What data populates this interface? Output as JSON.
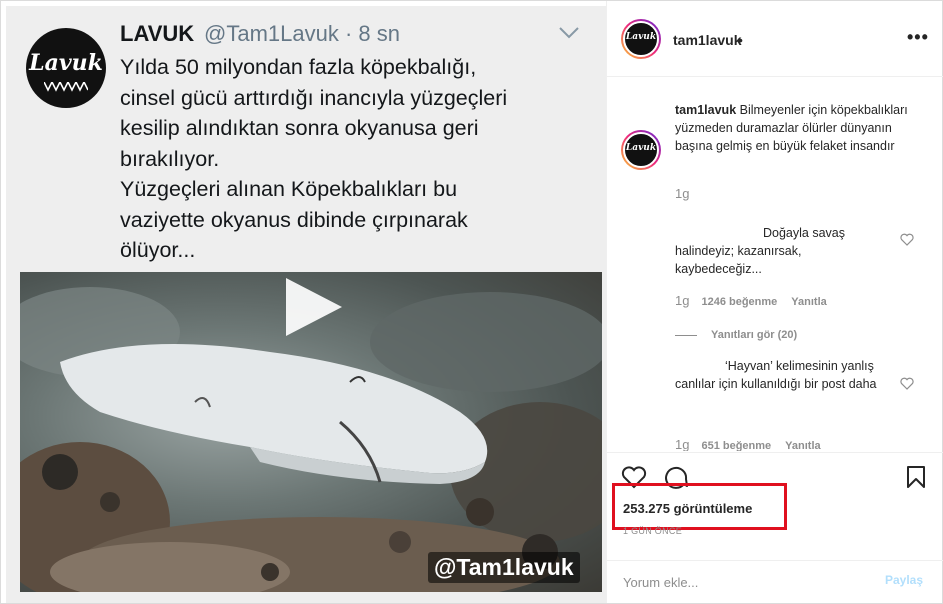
{
  "tweet": {
    "avatar_text": "Lavuk",
    "name": "LAVUK",
    "handle_time": "@Tam1Lavuk · 8 sn",
    "text": "Yılda 50 milyondan fazla  köpekbalığı,\ncinsel gücü arttırdığı inancıyla yüzgeçleri\nkesilip alındıktan sonra okyanusa geri\nbırakılıyor.\nYüzgeçleri alınan Köpekbalıkları bu\nvaziyette okyanus dibinde çırpınarak\nölüyor...",
    "watermark": "@Tam1lavuk"
  },
  "header": {
    "avatar_text": "Lavuk",
    "username": "tam1lavuk",
    "dot": "•",
    "more": "•••"
  },
  "caption": {
    "avatar_text": "Lavuk",
    "username": "tam1lavuk",
    "text": "Bilmeyenler için köpekbalıkları yüzmeden duramazlar ölürler dünyanın başına gelmiş en büyük felaket insandır",
    "time": "1g"
  },
  "comments": [
    {
      "text": "Doğayla savaş halindeyiz; kazanırsak, kaybedeceğiz...",
      "time": "1g",
      "likes": "1246 beğenme",
      "reply": "Yanıtla"
    },
    {
      "text": "‘Hayvan’ kelimesinin yanlış canlılar için kullanıldığı bir post daha",
      "time": "1g",
      "likes": "651 beğenme",
      "reply": "Yanıtla"
    }
  ],
  "view_replies": "Yanıtları gör (20)",
  "views": "253.275 görüntüleme",
  "time_ago": "1 GÜN ÖNCE",
  "add_comment": {
    "placeholder": "Yorum ekle..."
  },
  "post_label": "Paylaş",
  "colors": {
    "highlight_box": "#e0101f",
    "post_button": "#b2dffc"
  }
}
